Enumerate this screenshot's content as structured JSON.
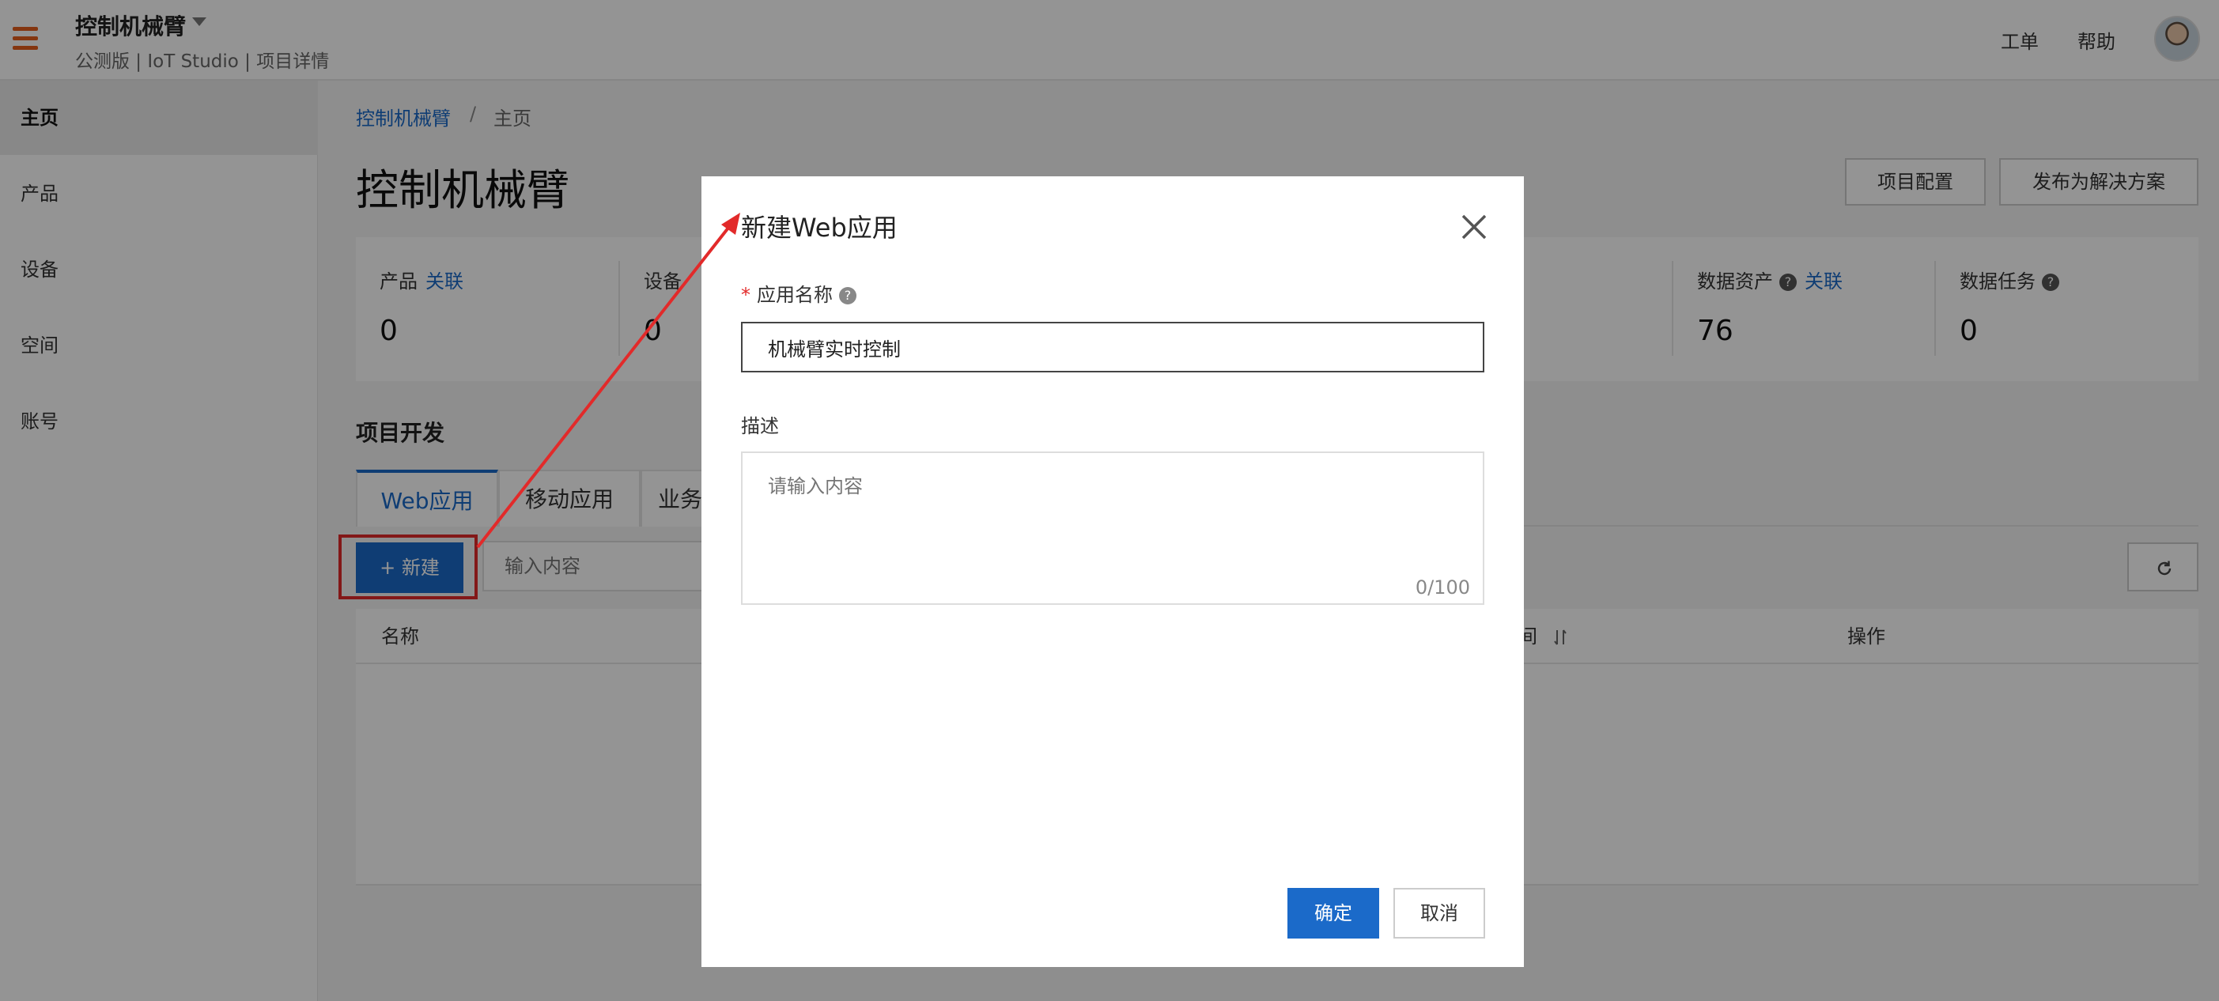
{
  "header": {
    "project_name": "控制机械臂",
    "subtitle": "公测版 | IoT Studio | 项目详情",
    "links": {
      "ticket": "工单",
      "help": "帮助"
    }
  },
  "sidebar": {
    "items": [
      {
        "label": "主页",
        "active": true
      },
      {
        "label": "产品",
        "active": false
      },
      {
        "label": "设备",
        "active": false
      },
      {
        "label": "空间",
        "active": false
      },
      {
        "label": "账号",
        "active": false
      }
    ]
  },
  "breadcrumb": {
    "parent": "控制机械臂",
    "separator": "/",
    "current": "主页"
  },
  "page": {
    "title": "控制机械臂",
    "buttons": {
      "project_config": "项目配置",
      "publish_solution": "发布为解决方案"
    }
  },
  "stats": [
    {
      "label": "产品",
      "link": "关联",
      "value": "0"
    },
    {
      "label": "设备",
      "value": "0"
    },
    {
      "label": "数据资产",
      "help": "?",
      "link": "关联",
      "value": "76"
    },
    {
      "label": "数据任务",
      "help": "?",
      "value": "0"
    }
  ],
  "project_dev": {
    "title": "项目开发",
    "tabs": [
      "Web应用",
      "移动应用",
      "业务"
    ],
    "new_button": "+ 新建",
    "search_placeholder": "输入内容",
    "table_headers": {
      "name": "名称",
      "time": "间",
      "actions": "操作"
    }
  },
  "dialog": {
    "title": "新建Web应用",
    "name_label": "应用名称",
    "required_mark": "*",
    "help_mark": "?",
    "name_value": "机械臂实时控制",
    "desc_label": "描述",
    "desc_placeholder": "请输入内容",
    "desc_counter": "0/100",
    "confirm": "确定",
    "cancel": "取消"
  },
  "colors": {
    "primary": "#1b6ac9",
    "accent_orange": "#e35d1c",
    "annotation_red": "#e22a2a"
  }
}
